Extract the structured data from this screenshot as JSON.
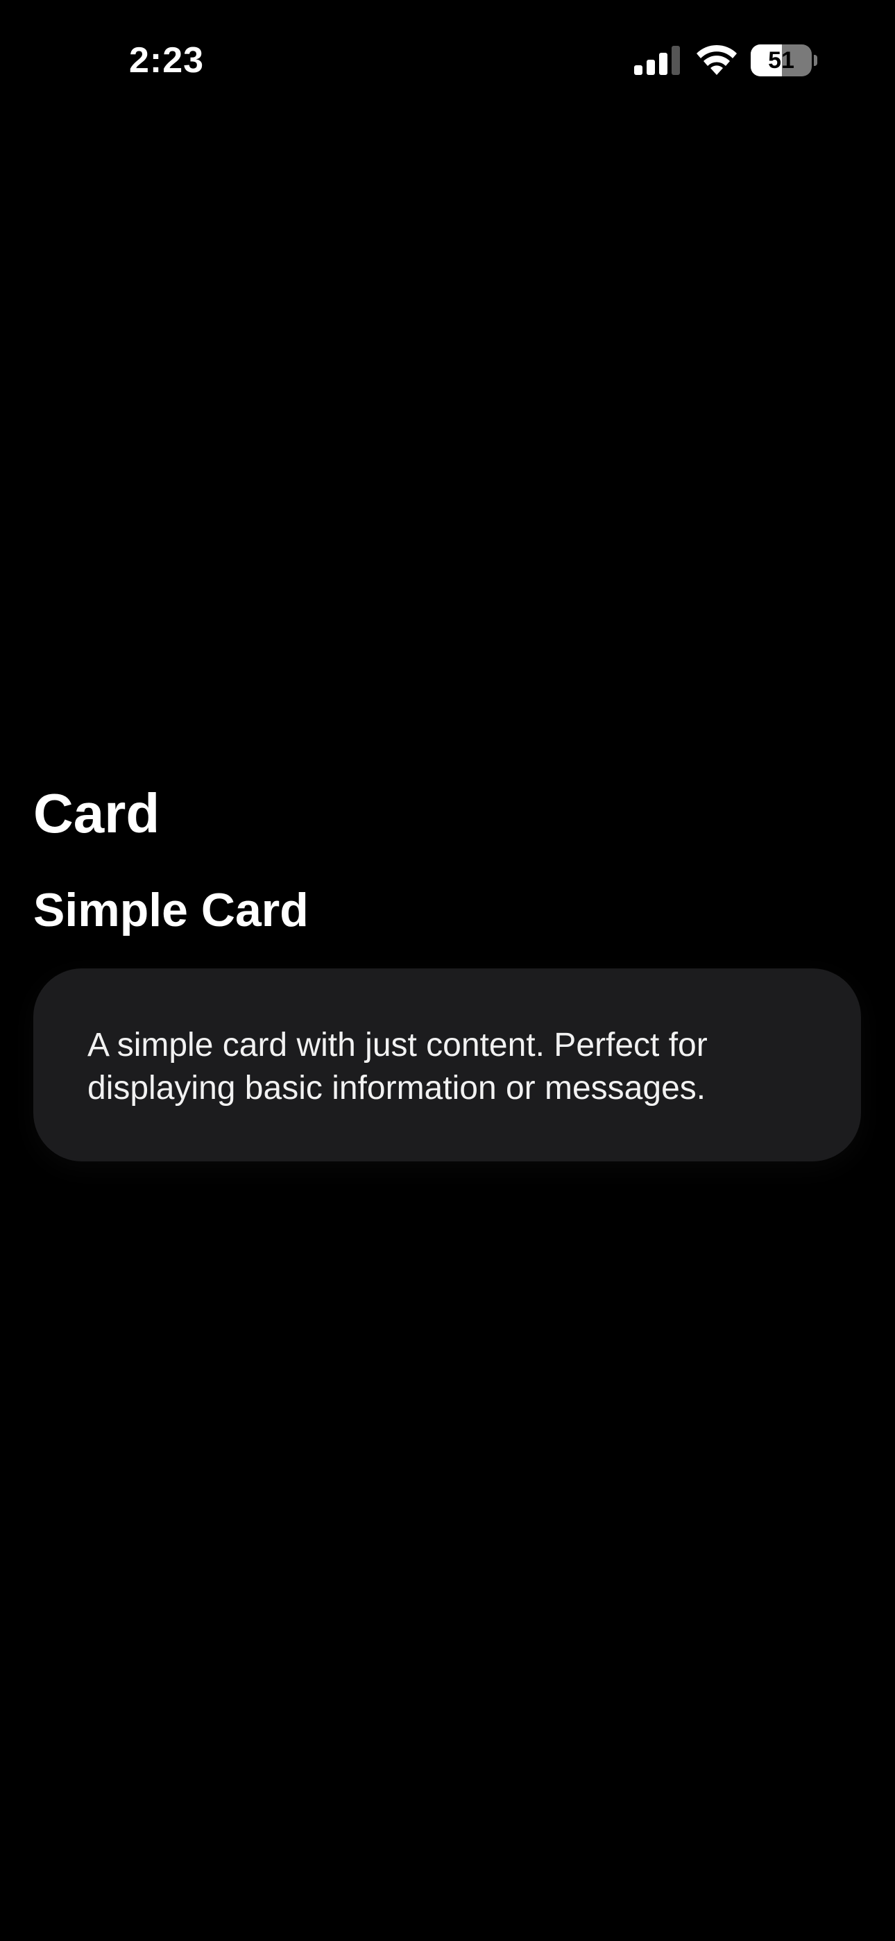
{
  "status_bar": {
    "time": "2:23",
    "signal_icon": "cellular-signal-icon",
    "signal_bars_active": 3,
    "signal_bars_total": 4,
    "wifi_icon": "wifi-icon",
    "battery_icon": "battery-icon",
    "battery_level": "51",
    "battery_fraction": 0.51
  },
  "page": {
    "title": "Card"
  },
  "sections": [
    {
      "title": "Simple Card",
      "card_text": "A simple card with just content. Perfect for displaying basic information or messages."
    }
  ],
  "colors": {
    "background": "#000000",
    "card_background": "#1c1c1e",
    "text_primary": "#ffffff"
  }
}
